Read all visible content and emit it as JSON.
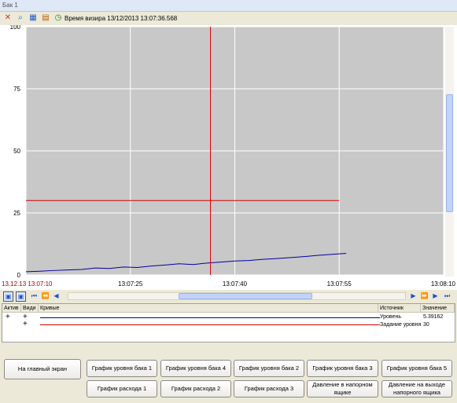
{
  "window": {
    "title": "Бак 1"
  },
  "toolbar": {
    "icons": [
      "cursor-off-icon",
      "zoom-icon",
      "stats-icon",
      "settings-icon",
      "clock-icon"
    ],
    "time_label": "Время визира 13/12/2013 13:07:36.568"
  },
  "chart_data": {
    "type": "line",
    "ylim": [
      0,
      100
    ],
    "yticks": [
      "100",
      "75",
      "50",
      "25",
      "0"
    ],
    "xticks": [
      "13.12.13 13:07:10",
      "13:07:25",
      "13:07:40",
      "13:07:55",
      "13:08:10"
    ],
    "x_seconds_range": [
      0,
      60
    ],
    "cursor_x": 26.5,
    "series": [
      {
        "name": "Уровень",
        "color": "#0000a0",
        "x": [
          0,
          2,
          4,
          6,
          8,
          10,
          12,
          14,
          16,
          18,
          20,
          22,
          24,
          26,
          28,
          30,
          32,
          34,
          36,
          38,
          40,
          42,
          44,
          46
        ],
        "values": [
          1.3,
          1.5,
          1.8,
          2.0,
          2.2,
          2.8,
          2.6,
          3.2,
          3.0,
          3.6,
          4.0,
          4.5,
          4.2,
          4.8,
          5.2,
          5.6,
          5.8,
          6.3,
          6.6,
          7.0,
          7.4,
          7.9,
          8.3,
          8.7
        ]
      },
      {
        "name": "Задание уровня",
        "color": "#d00000",
        "x": [
          0,
          45
        ],
        "values": [
          30,
          30
        ]
      }
    ],
    "grid": true,
    "background": "#c8c8c8"
  },
  "legend": {
    "headers": {
      "active": "Актив",
      "visible": "Види",
      "curves": "Кривые",
      "source": "Источник",
      "value": "Значение"
    },
    "rows": [
      {
        "active": "+",
        "visible": "+",
        "source": "Уровень",
        "value": "5.39162",
        "color": "#0000a0"
      },
      {
        "active": "",
        "visible": "+",
        "source": "Задание уровня",
        "value": "30",
        "color": "#d00000"
      }
    ]
  },
  "buttons": {
    "main_screen": "На главный экран",
    "level_1": "График уровня бака 1",
    "level_4": "График уровня бака 4",
    "level_2": "График уровня бака 2",
    "level_3": "График уровня бака 3",
    "level_5": "График уровня бака 5",
    "flow_1": "График расхода 1",
    "flow_2": "График расхода 2",
    "flow_3": "График расхода 3",
    "pressure_box": "Давление в напорном ящике",
    "pressure_out": "Давление на выходе напорного ящика"
  }
}
